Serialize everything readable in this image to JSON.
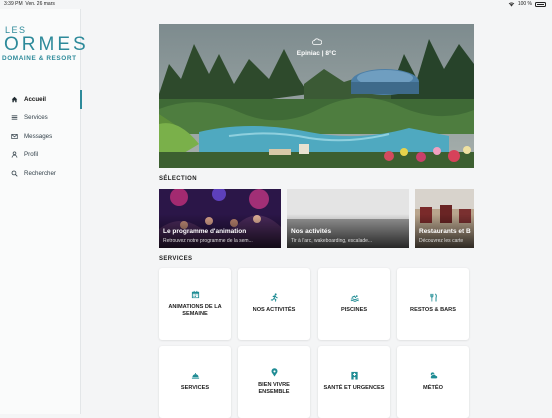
{
  "status": {
    "time": "3:39 PM",
    "date": "Ven. 26 mars",
    "battery": "100 %"
  },
  "logo": {
    "top": "LES",
    "main": "ORMES",
    "sub": "DOMAINE & RESORT"
  },
  "nav": [
    {
      "label": "Accueil",
      "icon": "home-icon",
      "active": true
    },
    {
      "label": "Services",
      "icon": "list-icon",
      "active": false
    },
    {
      "label": "Messages",
      "icon": "mail-icon",
      "active": false
    },
    {
      "label": "Profil",
      "icon": "user-icon",
      "active": false
    },
    {
      "label": "Rechercher",
      "icon": "search-icon",
      "active": false
    }
  ],
  "hero": {
    "weather": "Epiniac | 8°C",
    "weather_icon": "cloud-icon"
  },
  "selection": {
    "title": "SÉLECTION",
    "cards": [
      {
        "title": "Le programme d'animation",
        "subtitle": "Retrouvez notre programme de la sem..."
      },
      {
        "title": "Nos activités",
        "subtitle": "Tir à l'arc, wakeboarding, escalade..."
      },
      {
        "title": "Restaurants et B",
        "subtitle": "Découvrez les carte"
      }
    ]
  },
  "services": {
    "title": "SERVICES",
    "tiles": [
      {
        "label": "ANIMATIONS DE LA SEMAINE",
        "icon": "calendar-icon"
      },
      {
        "label": "NOS ACTIVITÉS",
        "icon": "runner-icon"
      },
      {
        "label": "PISCINES",
        "icon": "swimmer-icon"
      },
      {
        "label": "RESTOS & BARS",
        "icon": "cutlery-icon"
      },
      {
        "label": "SERVICES",
        "icon": "bell-icon"
      },
      {
        "label": "BIEN VIVRE ENSEMBLE",
        "icon": "pin-icon"
      },
      {
        "label": "SANTÉ ET URGENCES",
        "icon": "hospital-icon"
      },
      {
        "label": "MÉTÉO",
        "icon": "weather-icon"
      }
    ]
  },
  "colors": {
    "accent": "#2d8a9a",
    "icon": "#1f8c94"
  }
}
